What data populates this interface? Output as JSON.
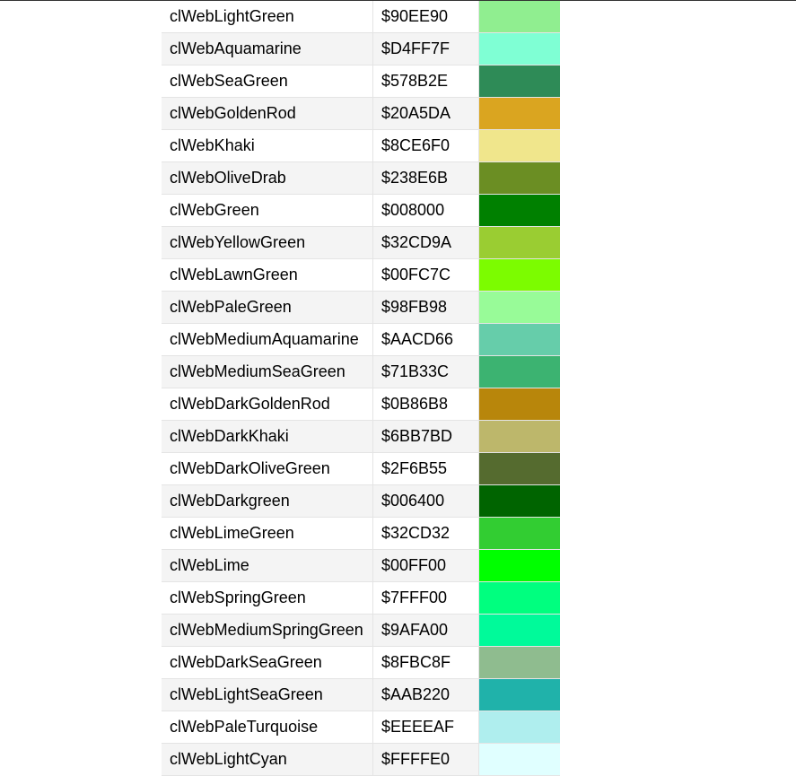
{
  "colors": [
    {
      "name": "clWebLightGreen",
      "value": "$90EE90",
      "swatch": "#90EE90"
    },
    {
      "name": "clWebAquamarine",
      "value": "$D4FF7F",
      "swatch": "#7FFFD4"
    },
    {
      "name": "clWebSeaGreen",
      "value": "$578B2E",
      "swatch": "#2E8B57"
    },
    {
      "name": "clWebGoldenRod",
      "value": "$20A5DA",
      "swatch": "#DAA520"
    },
    {
      "name": "clWebKhaki",
      "value": "$8CE6F0",
      "swatch": "#F0E68C"
    },
    {
      "name": "clWebOliveDrab",
      "value": "$238E6B",
      "swatch": "#6B8E23"
    },
    {
      "name": "clWebGreen",
      "value": "$008000",
      "swatch": "#008000"
    },
    {
      "name": "clWebYellowGreen",
      "value": "$32CD9A",
      "swatch": "#9ACD32"
    },
    {
      "name": "clWebLawnGreen",
      "value": "$00FC7C",
      "swatch": "#7CFC00"
    },
    {
      "name": "clWebPaleGreen",
      "value": "$98FB98",
      "swatch": "#98FB98"
    },
    {
      "name": "clWebMediumAquamarine",
      "value": "$AACD66",
      "swatch": "#66CDAA"
    },
    {
      "name": "clWebMediumSeaGreen",
      "value": "$71B33C",
      "swatch": "#3CB371"
    },
    {
      "name": "clWebDarkGoldenRod",
      "value": "$0B86B8",
      "swatch": "#B8860B"
    },
    {
      "name": "clWebDarkKhaki",
      "value": "$6BB7BD",
      "swatch": "#BDB76B"
    },
    {
      "name": "clWebDarkOliveGreen",
      "value": "$2F6B55",
      "swatch": "#556B2F"
    },
    {
      "name": "clWebDarkgreen",
      "value": "$006400",
      "swatch": "#006400"
    },
    {
      "name": "clWebLimeGreen",
      "value": "$32CD32",
      "swatch": "#32CD32"
    },
    {
      "name": "clWebLime",
      "value": "$00FF00",
      "swatch": "#00FF00"
    },
    {
      "name": "clWebSpringGreen",
      "value": "$7FFF00",
      "swatch": "#00FF7F"
    },
    {
      "name": "clWebMediumSpringGreen",
      "value": "$9AFA00",
      "swatch": "#00FA9A"
    },
    {
      "name": "clWebDarkSeaGreen",
      "value": "$8FBC8F",
      "swatch": "#8FBC8F"
    },
    {
      "name": "clWebLightSeaGreen",
      "value": "$AAB220",
      "swatch": "#20B2AA"
    },
    {
      "name": "clWebPaleTurquoise",
      "value": "$EEEEAF",
      "swatch": "#AFEEEE"
    },
    {
      "name": "clWebLightCyan",
      "value": "$FFFFE0",
      "swatch": "#E0FFFF"
    }
  ]
}
